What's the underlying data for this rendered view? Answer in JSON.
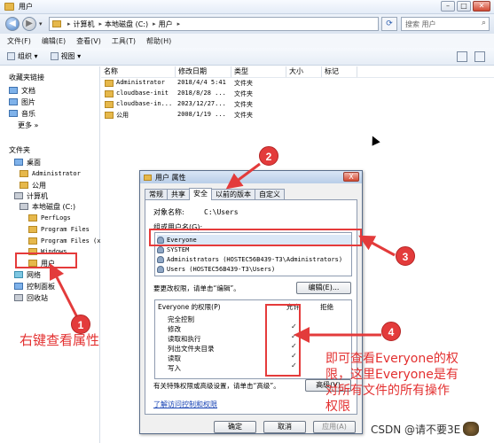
{
  "window": {
    "title": "用户"
  },
  "address": {
    "crumbs": [
      "计算机",
      "本地磁盘 (C:)",
      "用户"
    ],
    "search_placeholder": "搜索 用户"
  },
  "menu": [
    "文件(F)",
    "编辑(E)",
    "查看(V)",
    "工具(T)",
    "帮助(H)"
  ],
  "toolbar": {
    "organize": "组织 ▾",
    "view": "视图 ▾"
  },
  "nav": {
    "favorites": "收藏夹链接",
    "documents": "文档",
    "pictures": "图片",
    "music": "音乐",
    "more": "更多  »",
    "folders": "文件夹",
    "desktop": "桌面",
    "administrator": "Administrator",
    "public": "公用",
    "computer": "计算机",
    "local_disk": "本地磁盘 (C:)",
    "perflogs": "PerfLogs",
    "program_files": "Program Files",
    "program_files_x86": "Program Files (x",
    "windows": "Windows",
    "users": "用户",
    "network": "网络",
    "control_panel": "控制面板",
    "recycle_bin": "回收站"
  },
  "filelist": {
    "columns": [
      "名称",
      "修改日期",
      "类型",
      "大小",
      "标记"
    ],
    "rows": [
      {
        "name": "Administrator",
        "date": "2018/4/4 5:41",
        "type": "文件夹"
      },
      {
        "name": "cloudbase-init",
        "date": "2018/8/28 ...",
        "type": "文件夹"
      },
      {
        "name": "cloudbase-in...",
        "date": "2023/12/27...",
        "type": "文件夹"
      },
      {
        "name": "公用",
        "date": "2008/1/19 ...",
        "type": "文件夹"
      }
    ]
  },
  "dialog": {
    "title": "用户 属性",
    "close": "X",
    "tabs": [
      "常规",
      "共享",
      "安全",
      "以前的版本",
      "自定义"
    ],
    "object_label": "对象名称:",
    "object_value": "C:\\Users",
    "group_label": "组或用户名(G):",
    "groups": [
      "Everyone",
      "SYSTEM",
      "Administrators (HOSTEC56B439-T3\\Administrators)",
      "Users (HOSTEC56B439-T3\\Users)"
    ],
    "change_perm_text": "要更改权限，请单击“编辑”。",
    "edit_button": "编辑(E)...",
    "perm_header": "Everyone 的权限(P)",
    "allow": "允许",
    "deny": "拒绝",
    "permissions": [
      "完全控制",
      "修改",
      "读取和执行",
      "列出文件夹目录",
      "读取",
      "写入"
    ],
    "allowed_checks": [
      "✓",
      "✓",
      "✓",
      "✓",
      "✓"
    ],
    "special_text": "有关特殊权限或高级设置，请单击“高级”。",
    "advanced_button": "高级(V)",
    "learn_link": "了解访问控制和权限",
    "ok": "确定",
    "cancel": "取消",
    "apply": "应用(A)"
  },
  "annotations": {
    "n1": "1",
    "n2": "2",
    "n3": "3",
    "n4": "4",
    "text1": "右键查看属性",
    "text4_line1": "即可查看Everyone的权",
    "text4_line2": "限，这里Everyone是有",
    "text4_line3": "对所有文件的所有操作",
    "text4_line4": "权限",
    "red_color": "#e33b3b"
  },
  "watermark": "CSDN @请不要3E"
}
